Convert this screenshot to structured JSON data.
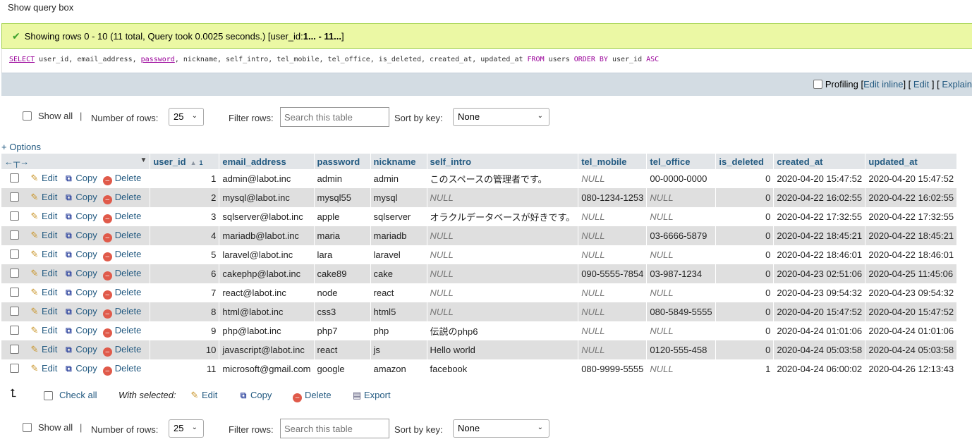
{
  "show_query_label": "Show query box",
  "success": {
    "message_prefix": "Showing rows 0 - 10 (11 total, Query took 0.0025 seconds.) [user_id: ",
    "message_range": "1... - 11...",
    "message_suffix": "]"
  },
  "sql": {
    "select": "SELECT",
    "columns_a": " user_id, email_address, ",
    "password": "password",
    "columns_b": ", nickname, self_intro, tel_mobile, tel_office, is_deleted, created_at, updated_at ",
    "from": "FROM",
    "table": " users ",
    "order_by": "ORDER BY",
    "order_col": " user_id ",
    "asc": "ASC"
  },
  "action_bar": {
    "profiling": "Profiling",
    "edit_inline": "Edit inline",
    "edit": "Edit",
    "explain": "Explain"
  },
  "nav": {
    "show_all": "Show all",
    "separator": "|",
    "number_of_rows": "Number of rows:",
    "rows_value": "25",
    "filter_rows": "Filter rows:",
    "search_placeholder": "Search this table",
    "sort_by_key": "Sort by key:",
    "sort_value": "None"
  },
  "options_label": "+ Options",
  "table": {
    "headers": [
      "user_id",
      "email_address",
      "password",
      "nickname",
      "self_intro",
      "tel_mobile",
      "tel_office",
      "is_deleted",
      "created_at",
      "updated_at"
    ],
    "sort_index": "1",
    "row_actions": {
      "edit": "Edit",
      "copy": "Copy",
      "delete": "Delete"
    },
    "null_text": "NULL",
    "rows": [
      [
        "1",
        "admin@labot.inc",
        "admin",
        "admin",
        "このスペースの管理者です。",
        "NULL",
        "00-0000-0000",
        "0",
        "2020-04-20 15:47:52",
        "2020-04-20 15:47:52"
      ],
      [
        "2",
        "mysql@labot.inc",
        "mysql55",
        "mysql",
        "NULL",
        "080-1234-1253",
        "NULL",
        "0",
        "2020-04-22 16:02:55",
        "2020-04-22 16:02:55"
      ],
      [
        "3",
        "sqlserver@labot.inc",
        "apple",
        "sqlserver",
        "オラクルデータベースが好きです。",
        "NULL",
        "NULL",
        "0",
        "2020-04-22 17:32:55",
        "2020-04-22 17:32:55"
      ],
      [
        "4",
        "mariadb@labot.inc",
        "maria",
        "mariadb",
        "NULL",
        "NULL",
        "03-6666-5879",
        "0",
        "2020-04-22 18:45:21",
        "2020-04-22 18:45:21"
      ],
      [
        "5",
        "laravel@labot.inc",
        "lara",
        "laravel",
        "NULL",
        "NULL",
        "NULL",
        "0",
        "2020-04-22 18:46:01",
        "2020-04-22 18:46:01"
      ],
      [
        "6",
        "cakephp@labot.inc",
        "cake89",
        "cake",
        "NULL",
        "090-5555-7854",
        "03-987-1234",
        "0",
        "2020-04-23 02:51:06",
        "2020-04-25 11:45:06"
      ],
      [
        "7",
        "react@labot.inc",
        "node",
        "react",
        "NULL",
        "NULL",
        "NULL",
        "0",
        "2020-04-23 09:54:32",
        "2020-04-23 09:54:32"
      ],
      [
        "8",
        "html@labot.inc",
        "css3",
        "html5",
        "NULL",
        "NULL",
        "080-5849-5555",
        "0",
        "2020-04-20 15:47:52",
        "2020-04-20 15:47:52"
      ],
      [
        "9",
        "php@labot.inc",
        "php7",
        "php",
        "伝説のphp6",
        "NULL",
        "NULL",
        "0",
        "2020-04-24 01:01:06",
        "2020-04-24 01:01:06"
      ],
      [
        "10",
        "javascript@labot.inc",
        "react",
        "js",
        "Hello world",
        "NULL",
        "0120-555-458",
        "0",
        "2020-04-24 05:03:58",
        "2020-04-24 05:03:58"
      ],
      [
        "11",
        "microsoft@gmail.com",
        "google",
        "amazon",
        "facebook",
        "080-9999-5555",
        "NULL",
        "1",
        "2020-04-24 06:00:02",
        "2020-04-26 12:13:43"
      ]
    ]
  },
  "bottom": {
    "check_all": "Check all",
    "with_selected": "With selected:",
    "edit": "Edit",
    "copy": "Copy",
    "delete": "Delete",
    "export": "Export"
  }
}
